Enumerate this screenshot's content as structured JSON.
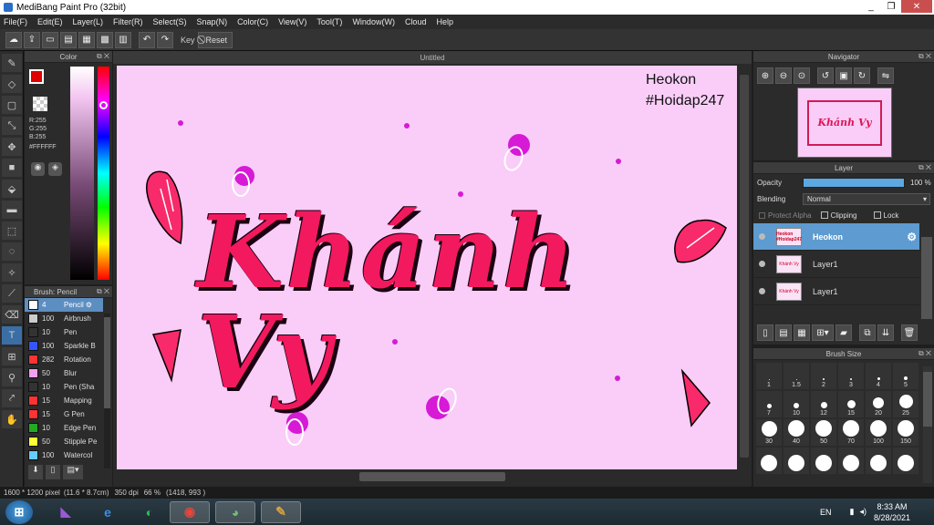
{
  "window": {
    "title": "MediBang Paint Pro (32bit)",
    "controls": [
      "_",
      "❐",
      "✕"
    ]
  },
  "menu": [
    "File(F)",
    "Edit(E)",
    "Layer(L)",
    "Filter(R)",
    "Select(S)",
    "Snap(N)",
    "Color(C)",
    "View(V)",
    "Tool(T)",
    "Window(W)",
    "Cloud",
    "Help"
  ],
  "toolbar": {
    "key_label": "Key",
    "reset_label": "Reset"
  },
  "color_panel": {
    "title": "Color",
    "rgb": [
      "R:255",
      "G:255",
      "B:255"
    ],
    "hex": "#FFFFFF",
    "fg_color": "#ffffff",
    "bg_color": "#e00000"
  },
  "brush_panel": {
    "title": "Brush: Pencil",
    "brushes": [
      {
        "size": "4",
        "name": "Pencil",
        "color": "#ffffff",
        "selected": true
      },
      {
        "size": "100",
        "name": "Airbrush",
        "color": "#cccccc"
      },
      {
        "size": "10",
        "name": "Pen",
        "color": "#333333"
      },
      {
        "size": "100",
        "name": "Sparkle B",
        "color": "#3355ff"
      },
      {
        "size": "282",
        "name": "Rotation",
        "color": "#ff3333"
      },
      {
        "size": "50",
        "name": "Blur",
        "color": "#f3a0f0"
      },
      {
        "size": "10",
        "name": "Pen (Sha",
        "color": "#333333"
      },
      {
        "size": "15",
        "name": "Mapping",
        "color": "#ff3333"
      },
      {
        "size": "15",
        "name": "G Pen",
        "color": "#ff3333"
      },
      {
        "size": "10",
        "name": "Edge Pen",
        "color": "#22aa22"
      },
      {
        "size": "50",
        "name": "Stipple Pe",
        "color": "#ffff33"
      },
      {
        "size": "100",
        "name": "Watercol",
        "color": "#66ccff"
      }
    ]
  },
  "canvas": {
    "tab_title": "Untitled",
    "watermark_line1": "Heokon",
    "watermark_line2": "#Hoidap247",
    "artwork_text": "Khánh Vy"
  },
  "navigator": {
    "title": "Navigator",
    "preview_text": "Khánh Vy"
  },
  "layer_panel": {
    "title": "Layer",
    "opacity_label": "Opacity",
    "opacity_value": "100 %",
    "opacity_fraction": 1.0,
    "blending_label": "Blending",
    "blending_value": "Normal",
    "protect_alpha": "Protect Alpha",
    "clipping": "Clipping",
    "lock": "Lock",
    "layers": [
      {
        "name": "Heokon",
        "thumb": "Heokon #Hoidap247",
        "selected": true
      },
      {
        "name": "Layer1",
        "thumb": "Khánh Vy"
      },
      {
        "name": "Layer1",
        "thumb": "Khánh Vy"
      }
    ]
  },
  "brush_size_panel": {
    "title": "Brush Size",
    "sizes": [
      "1",
      "1.5",
      "2",
      "3",
      "4",
      "5",
      "7",
      "10",
      "12",
      "15",
      "20",
      "25",
      "30",
      "40",
      "50",
      "70",
      "100",
      "150",
      "",
      "",
      "",
      "",
      "",
      ""
    ]
  },
  "status": {
    "dims": "1600 * 1200 pixel",
    "physical": "(11.6 * 8.7cm)",
    "dpi": "350 dpi",
    "zoom": "66 %",
    "cursor": "(1418, 993 )"
  },
  "taskbar": {
    "lang": "EN",
    "time": "8:33 AM",
    "date": "8/28/2021"
  }
}
